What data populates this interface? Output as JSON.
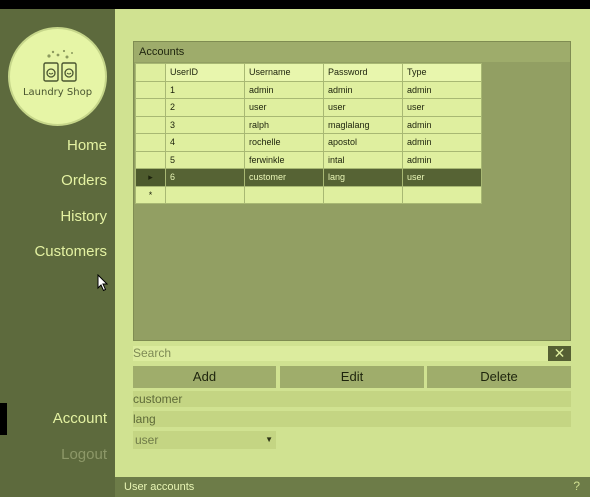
{
  "logo": {
    "text": "Laundry Shop",
    "icon": "washing-machines-icon"
  },
  "sidebar": {
    "nav": [
      {
        "label": "Home"
      },
      {
        "label": "Orders"
      },
      {
        "label": "History"
      },
      {
        "label": "Customers"
      }
    ],
    "bottom": [
      {
        "label": "Account"
      },
      {
        "label": "Logout"
      }
    ]
  },
  "accounts": {
    "title": "Accounts",
    "columns": [
      "UserID",
      "Username",
      "Password",
      "Type"
    ],
    "rows": [
      [
        "1",
        "admin",
        "admin",
        "admin"
      ],
      [
        "2",
        "user",
        "user",
        "user"
      ],
      [
        "3",
        "ralph",
        "maglalang",
        "admin"
      ],
      [
        "4",
        "rochelle",
        "apostol",
        "admin"
      ],
      [
        "5",
        "ferwinkle",
        "intal",
        "admin"
      ],
      [
        "6",
        "customer",
        "lang",
        "user"
      ]
    ],
    "selected_row_marker": "▸",
    "new_row_marker": "*"
  },
  "search": {
    "placeholder": "Search",
    "clear_icon": "close-icon"
  },
  "buttons": {
    "add": "Add",
    "edit": "Edit",
    "delete": "Delete"
  },
  "form": {
    "username": "customer",
    "password": "lang",
    "type": "user"
  },
  "status": {
    "text": "User accounts",
    "help": "?"
  },
  "colors": {
    "sidebar": "#5d6a3d",
    "main": "#d0e291",
    "accent": "#e4f2a2",
    "selected_row": "#566334"
  }
}
